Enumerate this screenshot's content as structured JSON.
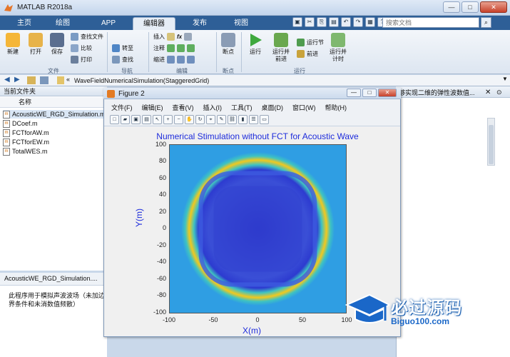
{
  "window": {
    "title": "MATLAB R2018a"
  },
  "tabs": [
    "主页",
    "绘图",
    "APP",
    "编辑器",
    "发布",
    "视图"
  ],
  "active_tab": "编辑器",
  "search": {
    "placeholder": "搜索文档"
  },
  "ribbon": {
    "file_group": {
      "label": "文件",
      "new": "新建",
      "open": "打开",
      "save": "保存",
      "find_files": "查找文件",
      "compare": "比较",
      "print": "打印"
    },
    "nav_group": {
      "label": "导航",
      "goto": "转至",
      "find": "查找"
    },
    "edit_group": {
      "label": "编辑",
      "insert": "插入",
      "comment": "注释",
      "indent": "缩进"
    },
    "bp_group": {
      "label": "断点",
      "breakpoint": "断点"
    },
    "run_group": {
      "label": "运行",
      "run": "运行",
      "run_advance": "运行并\n前进",
      "run_section": "运行节",
      "advance": "前进",
      "run_time": "运行并\n计时"
    }
  },
  "address": {
    "path": "WaveFieldNumericalSimulation(StaggeredGrid)"
  },
  "current_folder": {
    "header": "当前文件夹",
    "column": "名称",
    "files": [
      "AcousticWE_RGD_Simulation.m",
      "DCoef.m",
      "FCTforAW.m",
      "FCTforEW.m",
      "TotalWES.m"
    ]
  },
  "details": {
    "title": "AcousticWE_RGD_Simulation....",
    "text": "此程序用于模拟声波波场（未加边界条件和未消数值频散）"
  },
  "right_panel": {
    "header": "够实现二维的弹性波数值..."
  },
  "figure": {
    "title": "Figure 2",
    "menu": [
      "文件(F)",
      "编辑(E)",
      "查看(V)",
      "插入(I)",
      "工具(T)",
      "桌面(D)",
      "窗口(W)",
      "帮助(H)"
    ]
  },
  "chart_data": {
    "type": "heatmap",
    "title": "Numerical Stimulation without FCT for Acoustic Wave",
    "xlabel": "X(m)",
    "ylabel": "Y(m)",
    "xlim": [
      -100,
      100
    ],
    "ylim": [
      -100,
      100
    ],
    "xticks": [
      -100,
      -50,
      0,
      50,
      100
    ],
    "yticks": [
      100,
      80,
      60,
      40,
      20,
      0,
      -20,
      -40,
      -60,
      -80,
      -100
    ],
    "colors": {
      "background": "#2f9ee3",
      "ring_outer": "#f2c81e",
      "ring_mid": "#3ec3c2",
      "inner": "#2d3bd0"
    }
  },
  "brand": {
    "name": "必过源码",
    "url": "Biguo100.com"
  }
}
